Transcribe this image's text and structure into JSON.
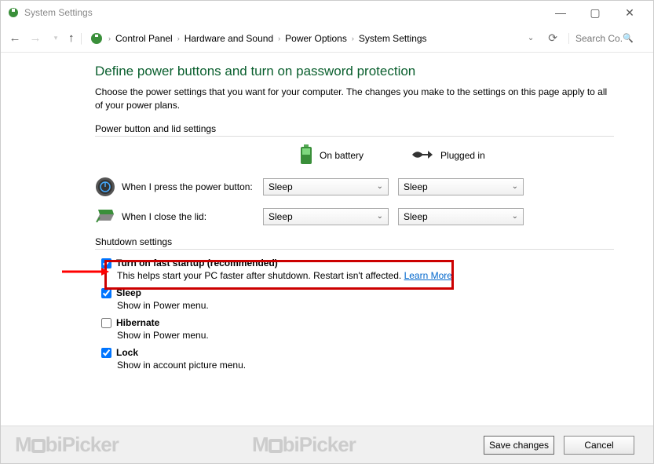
{
  "window": {
    "title": "System Settings"
  },
  "nav": {
    "breadcrumb": [
      "Control Panel",
      "Hardware and Sound",
      "Power Options",
      "System Settings"
    ],
    "search_placeholder": "Search Co..."
  },
  "page": {
    "heading": "Define power buttons and turn on password protection",
    "intro": "Choose the power settings that you want for your computer. The changes you make to the settings on this page apply to all of your power plans.",
    "section1": "Power button and lid settings",
    "col_battery": "On battery",
    "col_plugged": "Plugged in",
    "row_power_button": "When I press the power button:",
    "row_lid": "When I close the lid:",
    "selects": {
      "power_battery": "Sleep",
      "power_plugged": "Sleep",
      "lid_battery": "Sleep",
      "lid_plugged": "Sleep"
    },
    "section2": "Shutdown settings",
    "fast_startup": {
      "checked": true,
      "title": "Turn on fast startup (recommended)",
      "desc": "This helps start your PC faster after shutdown. Restart isn't affected.",
      "learn_more": "Learn More"
    },
    "sleep": {
      "checked": true,
      "title": "Sleep",
      "desc": "Show in Power menu."
    },
    "hibernate": {
      "checked": false,
      "title": "Hibernate",
      "desc": "Show in Power menu."
    },
    "lock": {
      "checked": true,
      "title": "Lock",
      "desc": "Show in account picture menu."
    }
  },
  "footer": {
    "save": "Save changes",
    "cancel": "Cancel"
  },
  "watermark": "MobiPicker"
}
